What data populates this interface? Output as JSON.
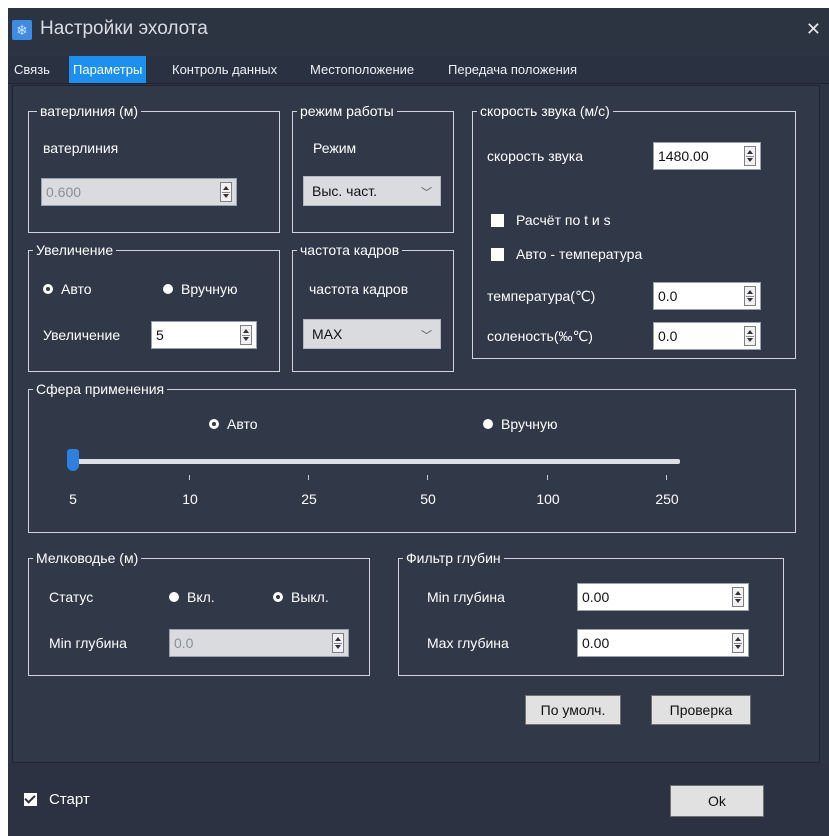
{
  "window": {
    "title": "Настройки эхолота"
  },
  "tabs": [
    "Связь",
    "Параметры",
    "Контроль данных",
    "Местоположение",
    "Передача положения"
  ],
  "waterline": {
    "legend": "ватерлиния (м)",
    "label": "ватерлиния",
    "value": "0.600"
  },
  "mode": {
    "legend": "режим работы",
    "label": "Режим",
    "selected": "Выс. част."
  },
  "sound_speed": {
    "legend": "скорость звука (м/с)",
    "label": "скорость звука",
    "value": "1480.00",
    "calc_ts": "Расчёт по t и s",
    "auto_temp": "Авто - температура",
    "temp_label": "температура(℃)",
    "temp_value": "0.0",
    "salinity_label": "соленость(‰℃)",
    "salinity_value": "0.0"
  },
  "gain": {
    "legend": "Увеличение",
    "auto": "Авто",
    "manual": "Вручную",
    "label": "Увеличение",
    "value": "5"
  },
  "frame_rate": {
    "legend": "частота кадров",
    "label": "частота кадров",
    "selected": "MAX"
  },
  "range": {
    "legend": "Сфера применения",
    "auto": "Авто",
    "manual": "Вручную",
    "ticks": [
      "5",
      "10",
      "25",
      "50",
      "100",
      "250"
    ],
    "selected_tick": "5"
  },
  "shallow": {
    "legend": "Мелководье (м)",
    "status_label": "Статус",
    "on": "Вкл.",
    "off": "Выкл.",
    "min_label": "Min глубина",
    "min_value": "0.0"
  },
  "depth_filter": {
    "legend": "Фильтр глубин",
    "min_label": "Min глубина",
    "min_value": "0.00",
    "max_label": "Max глубина",
    "max_value": "0.00"
  },
  "buttons": {
    "default": "По умолч.",
    "check": "Проверка",
    "ok": "Ok"
  },
  "start": {
    "label": "Старт"
  }
}
